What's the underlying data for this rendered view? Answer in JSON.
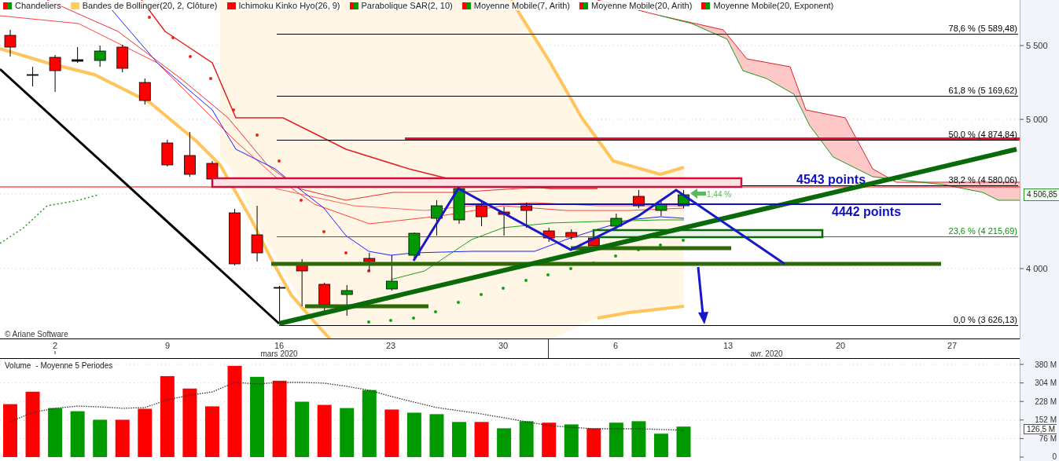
{
  "legend": [
    {
      "label": "Chandeliers",
      "kind": "updown"
    },
    {
      "label": "Bandes de Bollinger(20, 2, Clôture)",
      "kind": "solid",
      "color": "#ffcc66"
    },
    {
      "label": "Ichimoku Kinko Hyo(26, 9)",
      "kind": "solid",
      "color": "#ff0000"
    },
    {
      "label": "Parabolique SAR(2, 10)",
      "kind": "updown"
    },
    {
      "label": "Moyenne Mobile(7, Arith)",
      "kind": "updown"
    },
    {
      "label": "Moyenne Mobile(20, Arith)",
      "kind": "updown"
    },
    {
      "label": "Moyenne Mobile(20, Exponent)",
      "kind": "updown"
    }
  ],
  "price_axis": {
    "ticks": [
      "5 500",
      "5 000",
      "4 000"
    ],
    "last_price": "4 506,85"
  },
  "fibonacci": [
    {
      "label": "78,6 % (5 589,48)",
      "color": "#000000"
    },
    {
      "label": "61,8 % (5 169,62)",
      "color": "#000000"
    },
    {
      "label": "50,0 % (4 874,84)",
      "color": "#000000"
    },
    {
      "label": "38,2 % (4 580,06)",
      "color": "#000000"
    },
    {
      "label": "23,6 % (4 215,69)",
      "color": "#009900"
    },
    {
      "label": "0,0 % (3 626,13)",
      "color": "#000000"
    }
  ],
  "annotations": {
    "resistance": "4543 points",
    "support": "4442 points",
    "change": "1,44 %"
  },
  "copyright": "© Ariane Software",
  "date_axis": {
    "ticks": [
      "2",
      "9",
      "16",
      "23",
      "30",
      "6",
      "13",
      "20",
      "27"
    ],
    "months": [
      "mars 2020",
      "avr. 2020"
    ]
  },
  "volume": {
    "last_value": "126,5 M",
    "chart_data": {
      "type": "bar",
      "grid": true,
      "ylim": [
        0,
        380
      ],
      "yticks": [
        {
          "value": 0,
          "label": "0"
        },
        {
          "value": 76,
          "label": "76 M"
        },
        {
          "value": 152,
          "label": "152 M"
        },
        {
          "value": 228,
          "label": "228 M"
        },
        {
          "value": 304,
          "label": "304 M"
        },
        {
          "value": 380,
          "label": "380 M"
        }
      ],
      "series": [
        {
          "name": "Volume",
          "values": [
            217,
            268,
            201,
            188,
            153,
            153,
            198,
            332,
            281,
            208,
            374,
            329,
            313,
            227,
            214,
            201,
            275,
            195,
            182,
            176,
            144,
            144,
            118,
            147,
            141,
            134,
            118,
            141,
            147,
            96,
            125
          ],
          "colors": [
            "#ff0000",
            "#ff0000",
            "#009900",
            "#009900",
            "#009900",
            "#ff0000",
            "#ff0000",
            "#ff0000",
            "#ff0000",
            "#ff0000",
            "#ff0000",
            "#009900",
            "#ff0000",
            "#009900",
            "#ff0000",
            "#009900",
            "#009900",
            "#ff0000",
            "#009900",
            "#009900",
            "#009900",
            "#ff0000",
            "#009900",
            "#009900",
            "#ff0000",
            "#009900",
            "#ff0000",
            "#009900",
            "#009900",
            "#009900",
            "#009900"
          ]
        },
        {
          "name": "- Moyenne 5 Periodes",
          "type": "line",
          "line_style": "dashed",
          "color": "#333333",
          "values": [
            145,
            183,
            200,
            209,
            206,
            200,
            203,
            235,
            254,
            267,
            306,
            300,
            306,
            306,
            303,
            290,
            274,
            248,
            225,
            203,
            190,
            177,
            161,
            145,
            129,
            122,
            116,
            116,
            116,
            113,
            110
          ]
        }
      ]
    }
  }
}
